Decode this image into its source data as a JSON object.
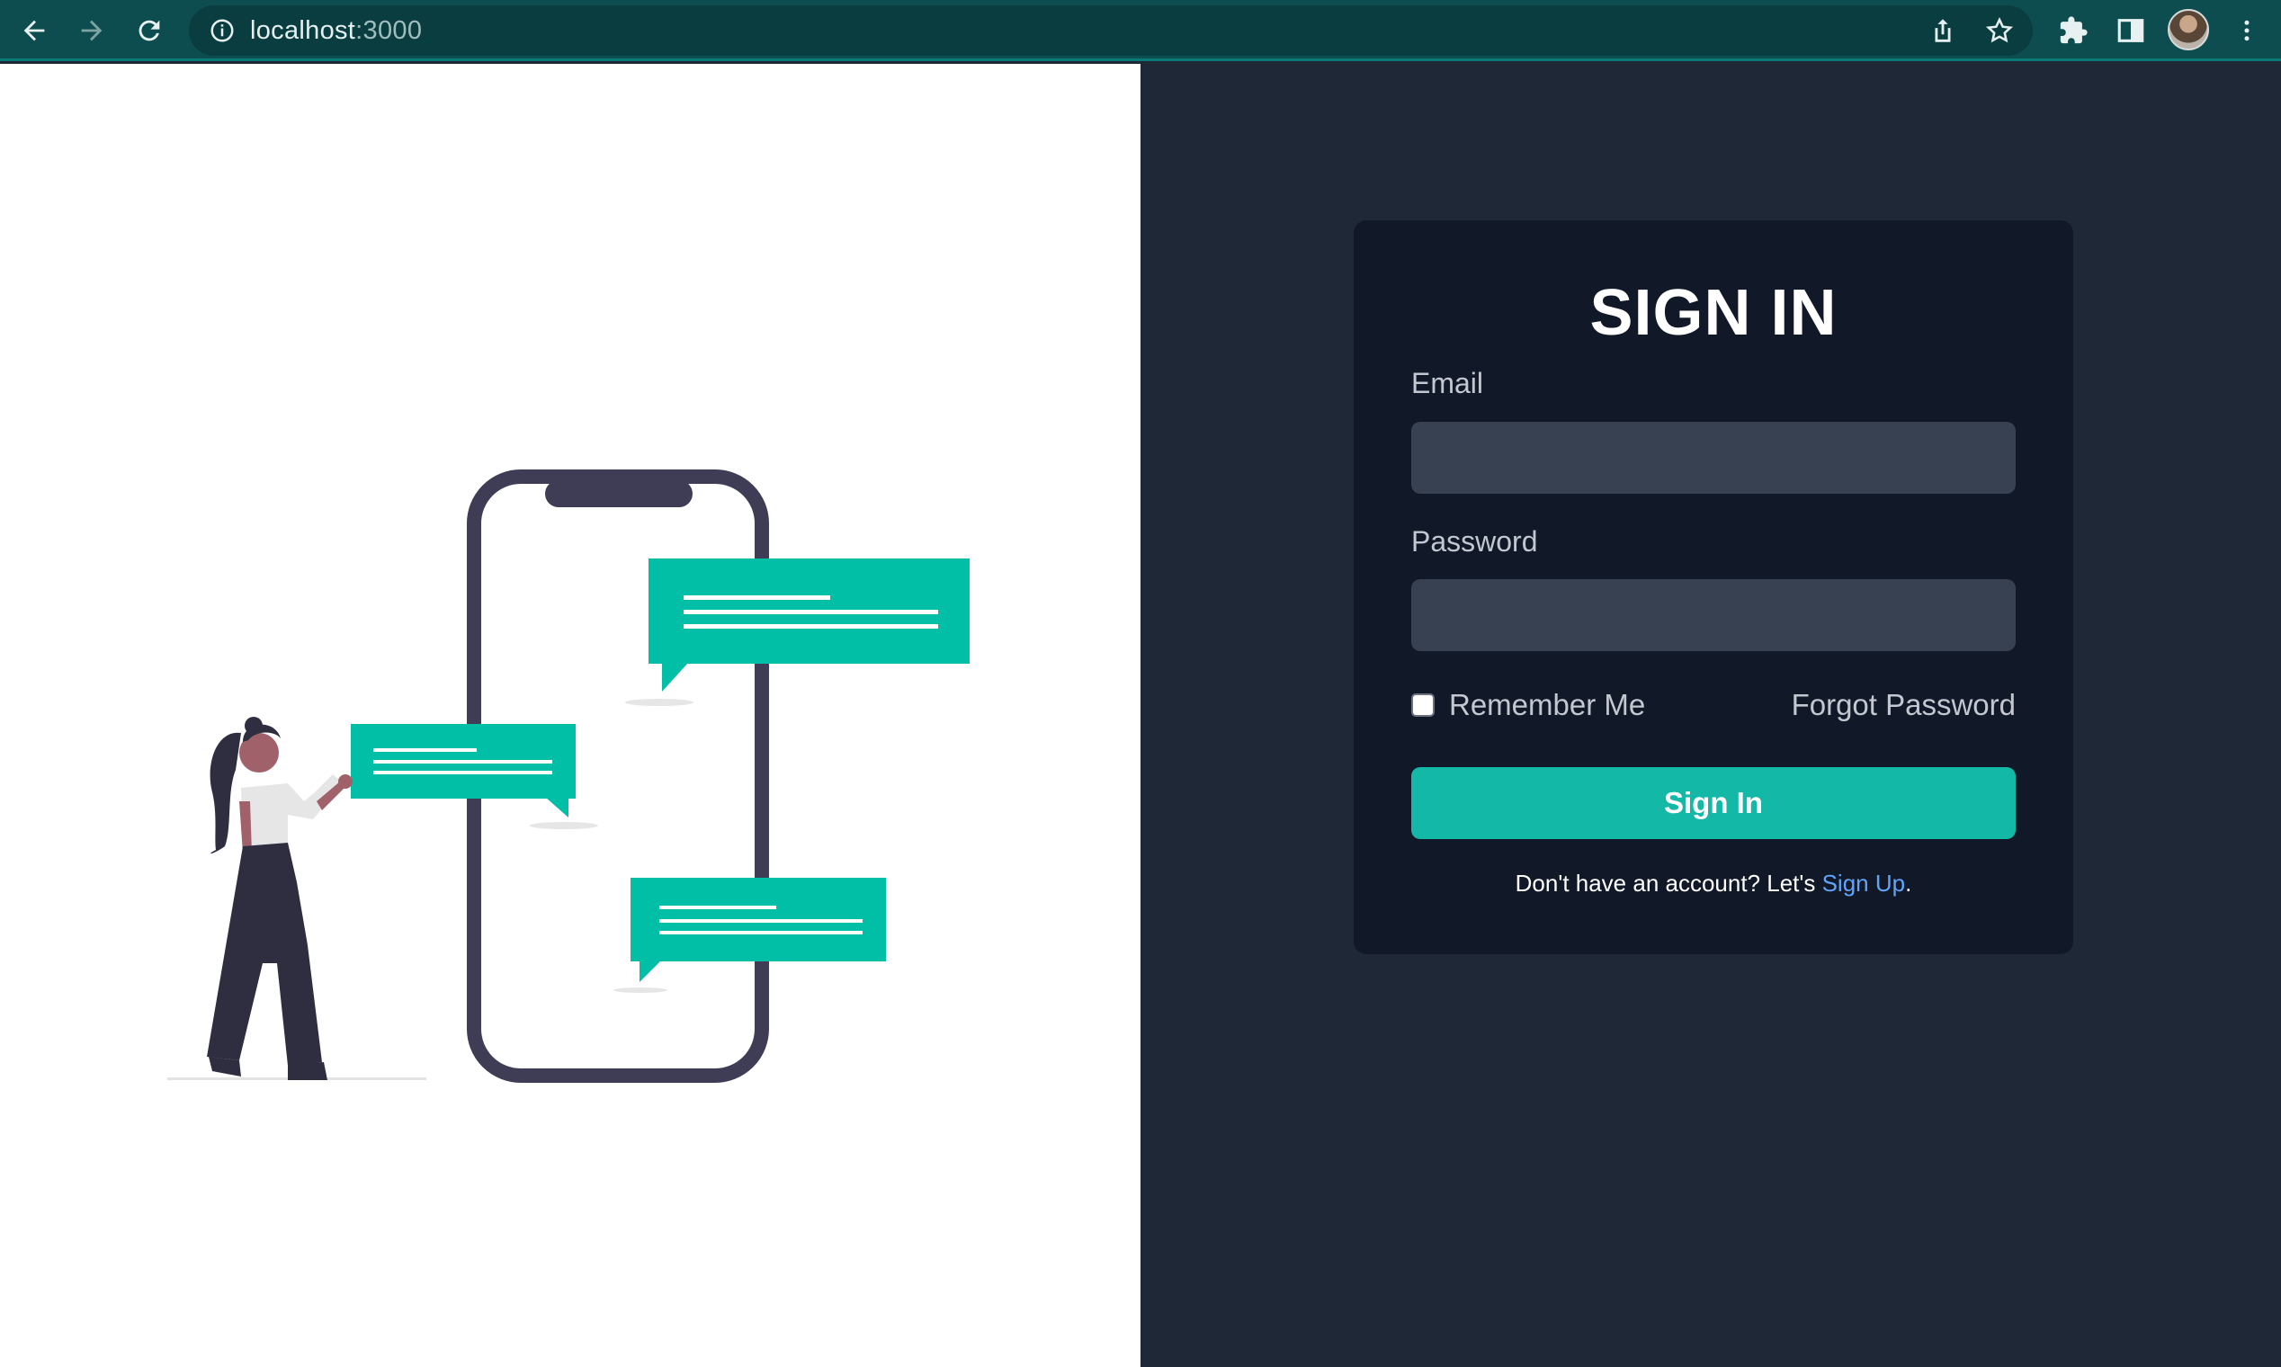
{
  "browser": {
    "url_host": "localhost",
    "url_port": ":3000"
  },
  "signin": {
    "title": "SIGN IN",
    "email_label": "Email",
    "email_value": "",
    "password_label": "Password",
    "password_value": "",
    "remember_label": "Remember Me",
    "remember_checked": false,
    "forgot_label": "Forgot Password",
    "submit_label": "Sign In",
    "signup_prefix": "Don't have an account? Let's ",
    "signup_link": "Sign Up",
    "signup_suffix": "."
  },
  "colors": {
    "accent": "#14b8a6",
    "chrome": "#0d4d50",
    "page_bg": "#1f2837",
    "card_bg": "#111827",
    "input_bg": "#374151",
    "link": "#60a5fa",
    "bubble": "#00bfa6",
    "phone_frame": "#3f3d56"
  },
  "icons": [
    "back-arrow-icon",
    "forward-arrow-icon",
    "reload-icon",
    "info-icon",
    "share-icon",
    "star-icon",
    "extensions-icon",
    "side-panel-icon",
    "more-vert-icon"
  ]
}
